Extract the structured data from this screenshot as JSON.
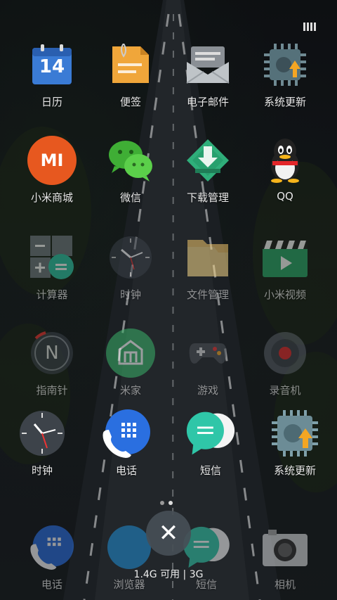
{
  "status_indicator": "battery-icon",
  "apps": [
    {
      "label": "日历",
      "icon": "calendar-icon",
      "day": "14"
    },
    {
      "label": "便签",
      "icon": "notes-icon"
    },
    {
      "label": "电子邮件",
      "icon": "email-icon"
    },
    {
      "label": "系统更新",
      "icon": "system-update-icon"
    },
    {
      "label": "小米商城",
      "icon": "mi-store-icon",
      "brand": "MI"
    },
    {
      "label": "微信",
      "icon": "wechat-icon"
    },
    {
      "label": "下载管理",
      "icon": "download-icon"
    },
    {
      "label": "QQ",
      "icon": "qq-icon"
    },
    {
      "label": "计算器",
      "icon": "calculator-icon"
    },
    {
      "label": "时钟",
      "icon": "clock-icon"
    },
    {
      "label": "文件管理",
      "icon": "file-manager-icon"
    },
    {
      "label": "小米视频",
      "icon": "mi-video-icon"
    },
    {
      "label": "指南针",
      "icon": "compass-icon",
      "letter": "N"
    },
    {
      "label": "米家",
      "icon": "mijia-icon"
    },
    {
      "label": "游戏",
      "icon": "game-icon"
    },
    {
      "label": "录音机",
      "icon": "recorder-icon"
    },
    {
      "label": "时钟",
      "icon": "clock-icon"
    },
    {
      "label": "电话",
      "icon": "phone-icon"
    },
    {
      "label": "短信",
      "icon": "message-icon"
    },
    {
      "label": "系统更新",
      "icon": "system-update-icon"
    }
  ],
  "dock": [
    {
      "label": "电话",
      "icon": "phone-icon"
    },
    {
      "label": "浏览器",
      "icon": "browser-icon"
    },
    {
      "label": "短信",
      "icon": "message-icon"
    },
    {
      "label": "相机",
      "icon": "camera-icon"
    }
  ],
  "recents": {
    "close_symbol": "✕",
    "memory_text": "1.4G 可用 | 3G"
  },
  "colors": {
    "mi_orange": "#e7581f",
    "wechat_green": "#4bc43c",
    "teal": "#2fc6a8",
    "blue": "#2a6fe0"
  }
}
